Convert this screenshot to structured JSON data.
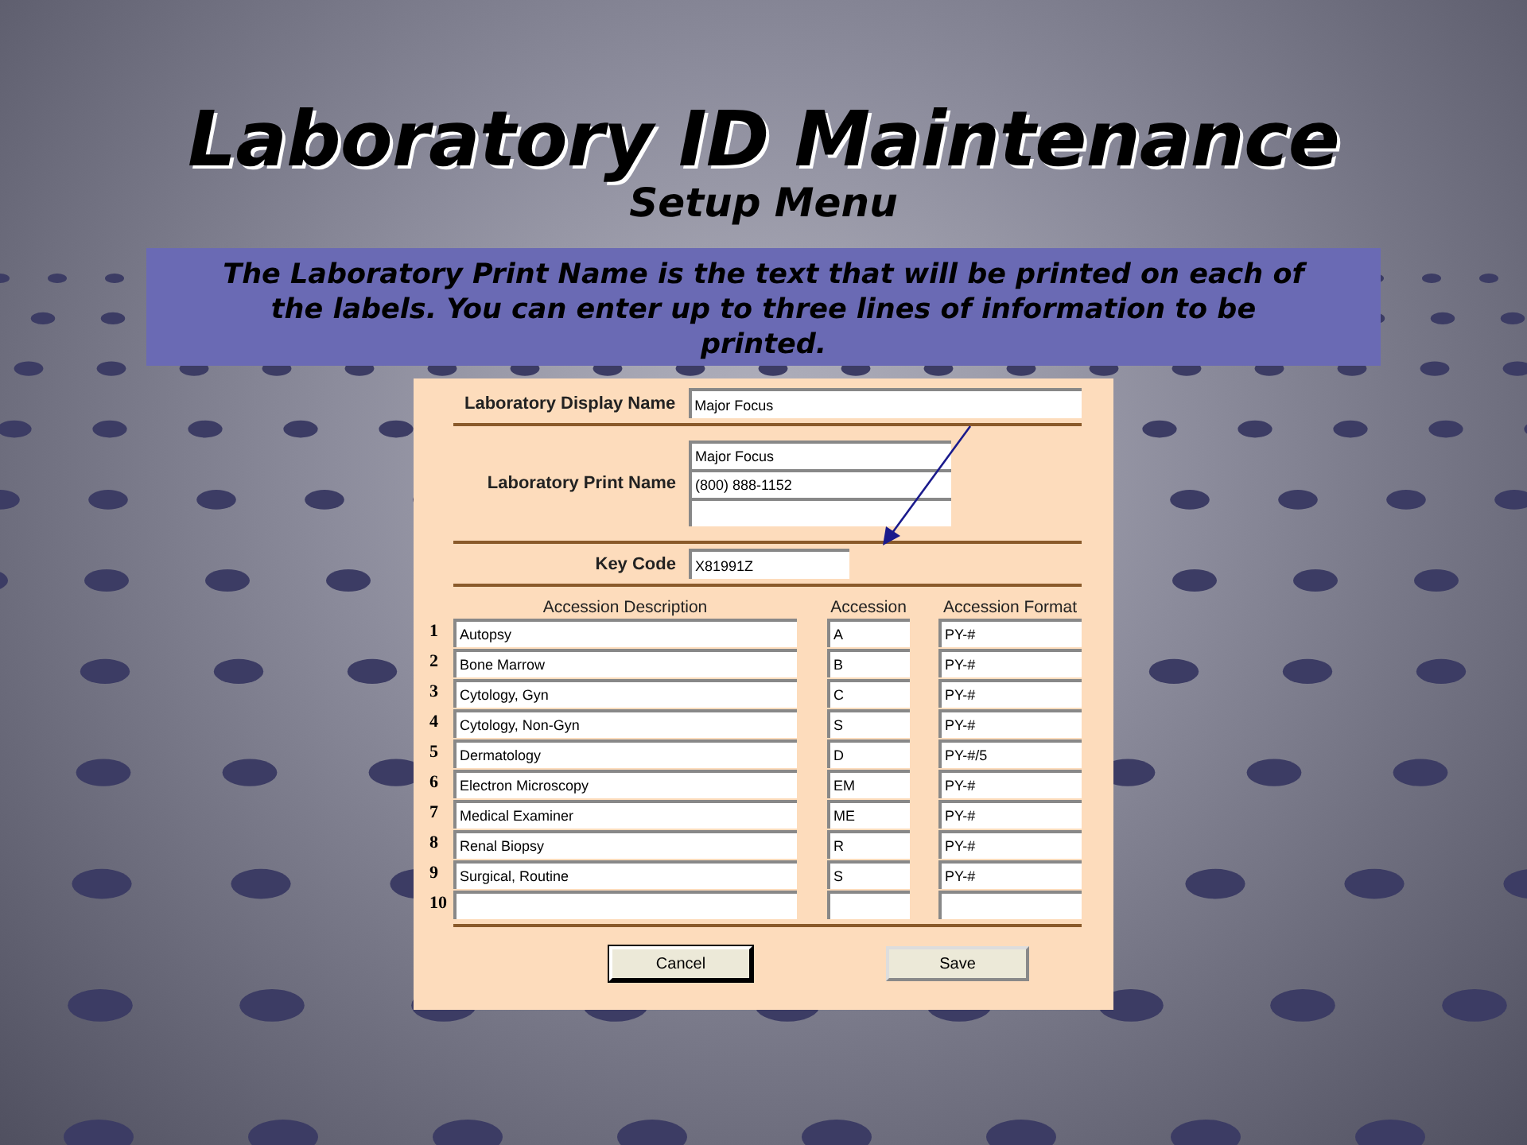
{
  "slide": {
    "title": "Laboratory ID Maintenance",
    "subtitle": "Setup Menu",
    "callout": "The Laboratory Print Name is the text that will be printed on each of the labels.  You can enter up to three lines of information to be printed."
  },
  "form": {
    "display_name": {
      "label": "Laboratory Display Name",
      "value": "Major Focus"
    },
    "print_name": {
      "label": "Laboratory Print Name",
      "lines": [
        {
          "kind": "filled",
          "text": "Major Focus"
        },
        {
          "kind": "filled",
          "text": "(800) 888-1152"
        },
        {
          "kind": "blank"
        }
      ]
    },
    "key_code": {
      "label": "Key Code",
      "value": "X81991Z"
    },
    "columns": [
      "Accession Description",
      "Accession",
      "Accession Format"
    ],
    "rows": [
      {
        "number": "1",
        "description": "Autopsy",
        "accession": "A",
        "format": "PY-#"
      },
      {
        "number": "2",
        "description": "Bone Marrow",
        "accession": "B",
        "format": "PY-#"
      },
      {
        "number": "3",
        "description": "Cytology, Gyn",
        "accession": "C",
        "format": "PY-#"
      },
      {
        "number": "4",
        "description": "Cytology, Non-Gyn",
        "accession": "S",
        "format": "PY-#"
      },
      {
        "number": "5",
        "description": "Dermatology",
        "accession": "D",
        "format": "PY-#/5"
      },
      {
        "number": "6",
        "description": "Electron Microscopy",
        "accession": "EM",
        "format": "PY-#"
      },
      {
        "number": "7",
        "description": "Medical Examiner",
        "accession": "ME",
        "format": "PY-#"
      },
      {
        "number": "8",
        "description": "Renal Biopsy",
        "accession": "R",
        "format": "PY-#"
      },
      {
        "number": "9",
        "description": "Surgical, Routine",
        "accession": "S",
        "format": "PY-#"
      },
      {
        "number": "10"
      }
    ],
    "buttons": [
      {
        "label": "Cancel",
        "focused": true
      },
      {
        "label": "Save",
        "focused": false
      }
    ]
  }
}
